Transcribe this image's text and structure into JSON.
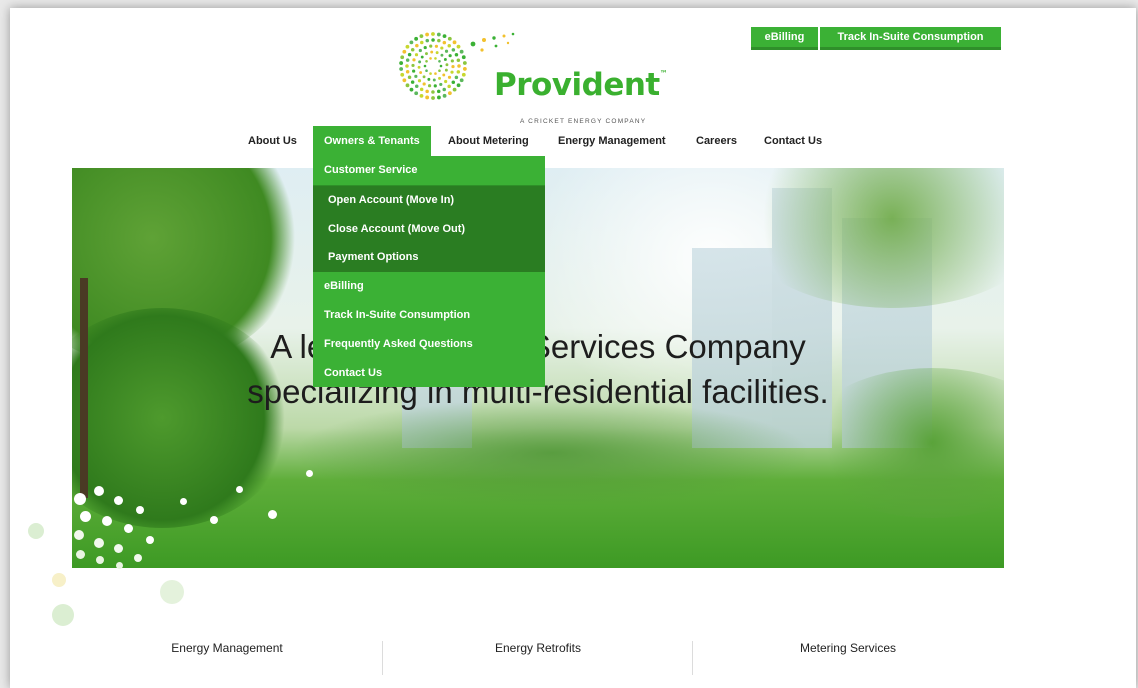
{
  "brand": {
    "name": "Provident",
    "trademark": "™",
    "tagline": "A CRICKET ENERGY COMPANY"
  },
  "top_links": {
    "ebilling": "eBilling",
    "track": "Track In-Suite Consumption"
  },
  "nav": {
    "items": [
      {
        "label": "About Us"
      },
      {
        "label": "Owners & Tenants"
      },
      {
        "label": "About Metering"
      },
      {
        "label": "Energy Management"
      },
      {
        "label": "Careers"
      },
      {
        "label": "Contact Us"
      }
    ],
    "active": "Owners & Tenants"
  },
  "dropdown": {
    "items": [
      {
        "label": "Customer Service",
        "level": 1
      },
      {
        "label": "Open Account (Move In)",
        "level": 2
      },
      {
        "label": "Close Account (Move Out)",
        "level": 2
      },
      {
        "label": "Payment Options",
        "level": 2
      },
      {
        "label": "eBilling",
        "level": 1
      },
      {
        "label": "Track In-Suite Consumption",
        "level": 1
      },
      {
        "label": "Frequently Asked Questions",
        "level": 1
      },
      {
        "label": "Contact Us",
        "level": 1
      }
    ]
  },
  "hero": {
    "line1": "A leading Energy Services Company",
    "line2": "specializing in multi-residential facilities."
  },
  "services": {
    "items": [
      {
        "label": "Energy Management"
      },
      {
        "label": "Energy Retrofits"
      },
      {
        "label": "Metering Services"
      }
    ]
  },
  "colors": {
    "brand_green": "#3bb135",
    "submenu_green": "#2a7d22"
  },
  "icons": {
    "logo": "provident-starburst-icon"
  }
}
